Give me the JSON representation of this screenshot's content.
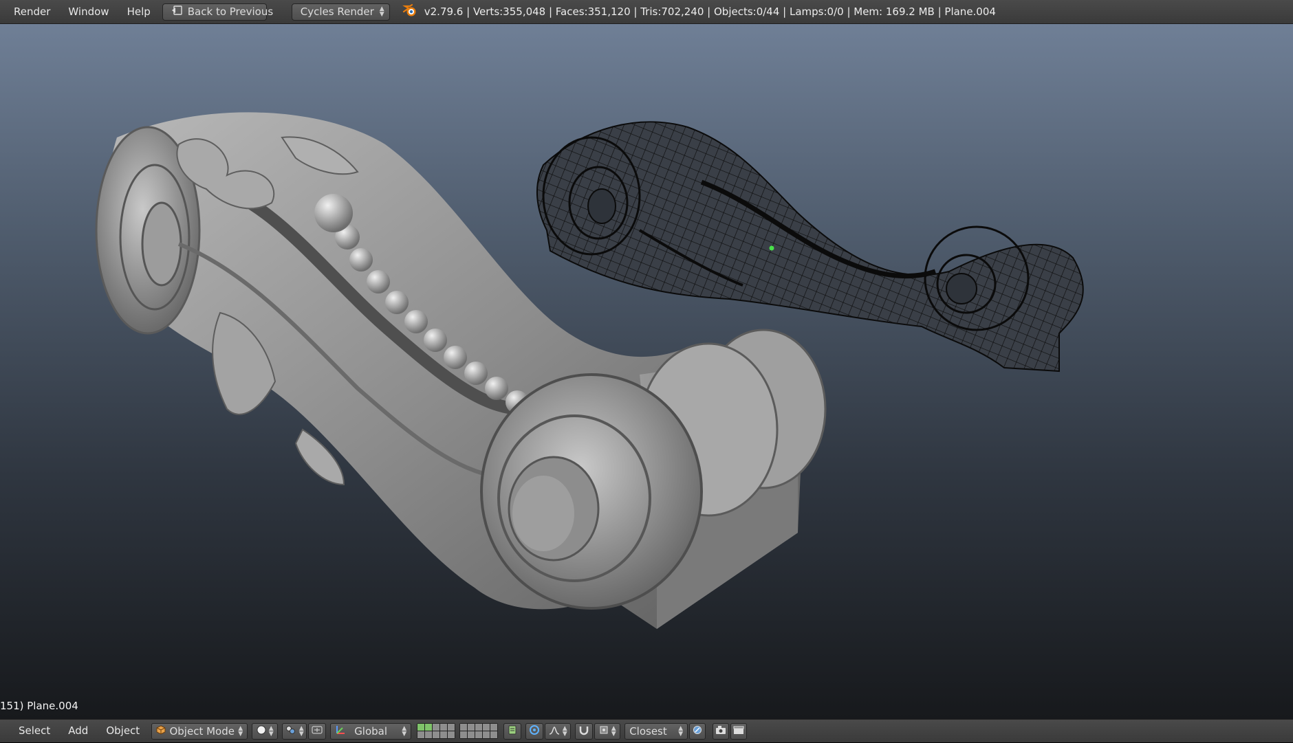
{
  "header": {
    "menus": [
      "Render",
      "Window",
      "Help"
    ],
    "back_button": "Back to Previous",
    "render_engine": "Cycles Render",
    "stats": "v2.79.6 | Verts:355,048 | Faces:351,120 | Tris:702,240 | Objects:0/44 | Lamps:0/0 | Mem: 169.2 MB | Plane.004"
  },
  "viewport": {
    "object_label": "151) Plane.004"
  },
  "view_header": {
    "menus": [
      "Select",
      "Add",
      "Object"
    ],
    "mode": "Object Mode",
    "orientation": "Global",
    "snap_target": "Closest"
  },
  "icons": {
    "blender_logo": "blender-logo-icon",
    "back": "back-arrow-icon",
    "mode": "cube-icon",
    "shading": "solid-sphere-icon",
    "pivot": "pivot-icon",
    "manipulator": "manipulator-icon",
    "proportional": "proportional-edit-icon",
    "snap": "magnet-icon",
    "render": "camera-icon"
  },
  "colors": {
    "header_bg": "#3d3d3d",
    "viewport_top": "#6f7f96",
    "viewport_bottom": "#17191c",
    "accent": "#e87d0d",
    "layer_active": "#7fc36a"
  }
}
